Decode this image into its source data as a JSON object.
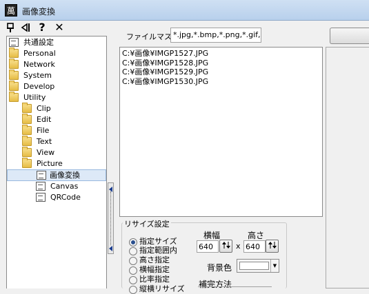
{
  "window": {
    "title": "画像変換",
    "app_icon_glyph": "萬"
  },
  "toolbar": {
    "icons": [
      "pin-icon",
      "back-to-start-icon",
      "help-icon",
      "close-icon"
    ],
    "help_glyph": "?",
    "close_glyph": "✕"
  },
  "tree": {
    "items": [
      {
        "label": "共通設定",
        "icon": "document-icon",
        "level": 0
      },
      {
        "label": "Personal",
        "icon": "folder-icon",
        "level": 0
      },
      {
        "label": "Network",
        "icon": "folder-icon",
        "level": 0
      },
      {
        "label": "System",
        "icon": "folder-icon",
        "level": 0
      },
      {
        "label": "Develop",
        "icon": "folder-icon",
        "level": 0
      },
      {
        "label": "Utility",
        "icon": "folder-icon",
        "level": 0
      },
      {
        "label": "Clip",
        "icon": "folder-icon",
        "level": 1
      },
      {
        "label": "Edit",
        "icon": "folder-icon",
        "level": 1
      },
      {
        "label": "File",
        "icon": "folder-icon",
        "level": 1
      },
      {
        "label": "Text",
        "icon": "folder-icon",
        "level": 1
      },
      {
        "label": "View",
        "icon": "folder-icon",
        "level": 1
      },
      {
        "label": "Picture",
        "icon": "folder-icon",
        "level": 1
      },
      {
        "label": "画像変換",
        "icon": "document-icon",
        "level": 2,
        "selected": true
      },
      {
        "label": "Canvas",
        "icon": "document-icon",
        "level": 2
      },
      {
        "label": "QRCode",
        "icon": "document-icon",
        "level": 2
      }
    ]
  },
  "file_mask": {
    "label": "ファイルマスク",
    "value": "*.jpg,*.bmp,*.png,*.gif,"
  },
  "files": [
    "C:¥画像¥IMGP1527.JPG",
    "C:¥画像¥IMGP1528.JPG",
    "C:¥画像¥IMGP1529.JPG",
    "C:¥画像¥IMGP1530.JPG"
  ],
  "resize": {
    "group_label": "リサイズ設定",
    "options": [
      "指定サイズ",
      "指定範囲内",
      "高さ指定",
      "横幅指定",
      "比率指定",
      "縦横リサイズ"
    ],
    "selected_index": 0,
    "width_label": "横幅",
    "height_label": "高さ",
    "width_value": "640",
    "height_value": "640",
    "times_symbol": "x",
    "bg_color_label": "背景色",
    "bg_color": "#ffffff",
    "interp_label": "補完方法"
  },
  "colors": {
    "accent": "#2a4f8e",
    "selection": "#dde9f7"
  }
}
